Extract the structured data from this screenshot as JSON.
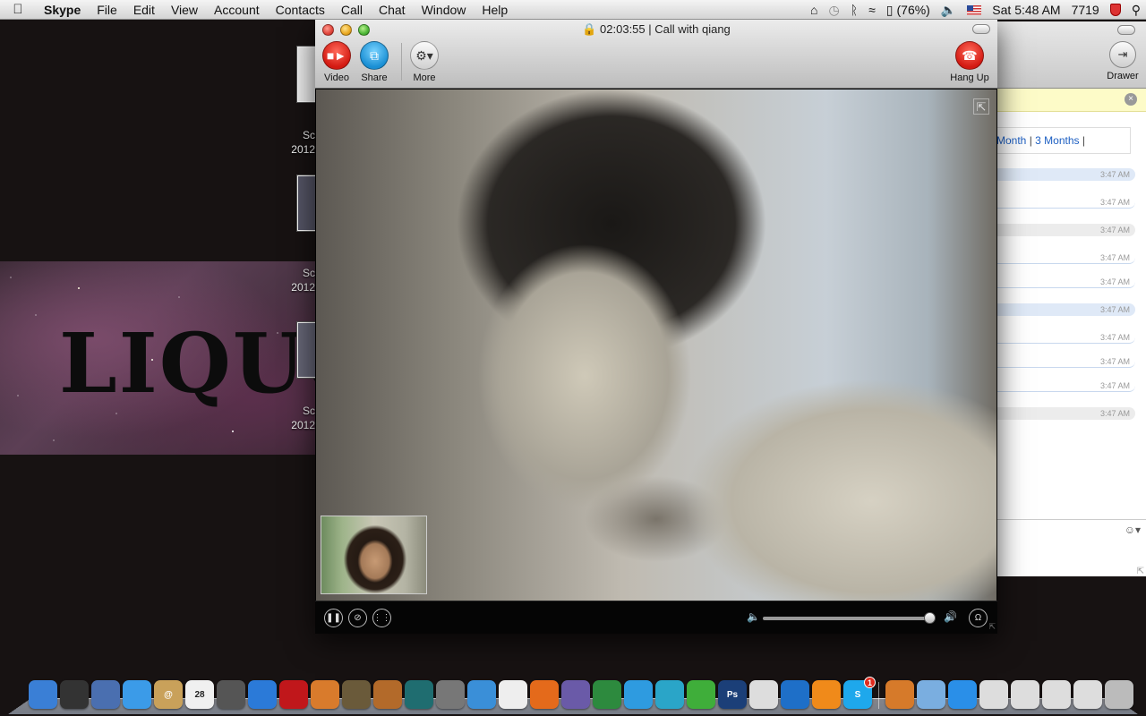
{
  "menubar": {
    "app": "Skype",
    "items": [
      "File",
      "Edit",
      "View",
      "Account",
      "Contacts",
      "Call",
      "Chat",
      "Window",
      "Help"
    ],
    "battery": "(76%)",
    "clock": "Sat 5:48 AM",
    "counter": "7719"
  },
  "desktop": {
    "banner_text": "LIQUO",
    "files": [
      {
        "line1": "Sc",
        "line2": "2012"
      },
      {
        "line1": "Sc",
        "line2": "2012"
      },
      {
        "line1": "Sc",
        "line2": "2012"
      }
    ]
  },
  "call_window": {
    "title": "02:03:55 | Call with qiang",
    "buttons": {
      "video": "Video",
      "share": "Share",
      "more": "More",
      "hangup": "Hang Up"
    },
    "volume_level": 0.98
  },
  "chat_window": {
    "drawer_label": "Drawer",
    "links": [
      "Month",
      "3 Months"
    ],
    "messages": [
      {
        "time": "3:47 AM",
        "style": "blue"
      },
      {
        "time": "3:47 AM",
        "style": "line"
      },
      {
        "time": "3:47 AM",
        "style": "gray"
      },
      {
        "time": "3:47 AM",
        "style": "line"
      },
      {
        "time": "3:47 AM",
        "style": "line"
      },
      {
        "time": "3:47 AM",
        "style": "blue"
      },
      {
        "time": "3:47 AM",
        "style": "line"
      },
      {
        "time": "3:47 AM",
        "style": "line"
      },
      {
        "time": "3:47 AM",
        "style": "line"
      },
      {
        "time": "3:47 AM",
        "style": "gray"
      }
    ]
  },
  "dock": {
    "apps": [
      {
        "name": "finder-icon",
        "color": "#3a7fd6",
        "label": ""
      },
      {
        "name": "dashboard-icon",
        "color": "#333333",
        "label": ""
      },
      {
        "name": "preview-icon",
        "color": "#4a6fb0",
        "label": ""
      },
      {
        "name": "ichat-icon",
        "color": "#3b9be8",
        "label": ""
      },
      {
        "name": "address-book-icon",
        "color": "#c9a15a",
        "label": "@"
      },
      {
        "name": "ical-icon",
        "color": "#f0f0f0",
        "label": "28"
      },
      {
        "name": "photo-booth-icon",
        "color": "#555555",
        "label": ""
      },
      {
        "name": "itunes-icon",
        "color": "#2b7ad8",
        "label": ""
      },
      {
        "name": "photo-album-icon",
        "color": "#c0171b",
        "label": ""
      },
      {
        "name": "iphoto-icon",
        "color": "#d97b2c",
        "label": ""
      },
      {
        "name": "imovie-icon",
        "color": "#6a5a3a",
        "label": ""
      },
      {
        "name": "garageband-icon",
        "color": "#b36a2a",
        "label": ""
      },
      {
        "name": "time-machine-icon",
        "color": "#1f6d70",
        "label": ""
      },
      {
        "name": "system-preferences-icon",
        "color": "#777777",
        "label": ""
      },
      {
        "name": "safari-icon",
        "color": "#3a8fd8",
        "label": ""
      },
      {
        "name": "textedit-icon",
        "color": "#eeeeee",
        "label": ""
      },
      {
        "name": "keynote-icon",
        "color": "#e46a1b",
        "label": ""
      },
      {
        "name": "quill-icon",
        "color": "#6a5aa8",
        "label": ""
      },
      {
        "name": "numbers-icon",
        "color": "#2d8a3e",
        "label": ""
      },
      {
        "name": "messenger-icon",
        "color": "#2e9be0",
        "label": ""
      },
      {
        "name": "frostwire-icon",
        "color": "#2aa5c8",
        "label": ""
      },
      {
        "name": "limewire-icon",
        "color": "#3fae3a",
        "label": ""
      },
      {
        "name": "photoshop-icon",
        "color": "#1b3f78",
        "label": "Ps"
      },
      {
        "name": "widget-icon",
        "color": "#dddddd",
        "label": ""
      },
      {
        "name": "quicktime-icon",
        "color": "#1e6fc8",
        "label": ""
      },
      {
        "name": "vlc-icon",
        "color": "#f08a1a",
        "label": ""
      },
      {
        "name": "skype-icon",
        "color": "#1ea8ec",
        "label": "S",
        "badge": "1"
      }
    ],
    "right_items": [
      {
        "name": "package-icon",
        "color": "#d67a2a"
      },
      {
        "name": "applications-folder-icon",
        "color": "#7aaee0"
      },
      {
        "name": "app-store-icon",
        "color": "#2a8fe8"
      },
      {
        "name": "stack-1-icon",
        "color": "#dddddd"
      },
      {
        "name": "stack-2-icon",
        "color": "#dddddd"
      },
      {
        "name": "stack-3-icon",
        "color": "#dddddd"
      },
      {
        "name": "stack-4-icon",
        "color": "#dddddd"
      },
      {
        "name": "trash-icon",
        "color": "#bbbbbb"
      }
    ]
  }
}
